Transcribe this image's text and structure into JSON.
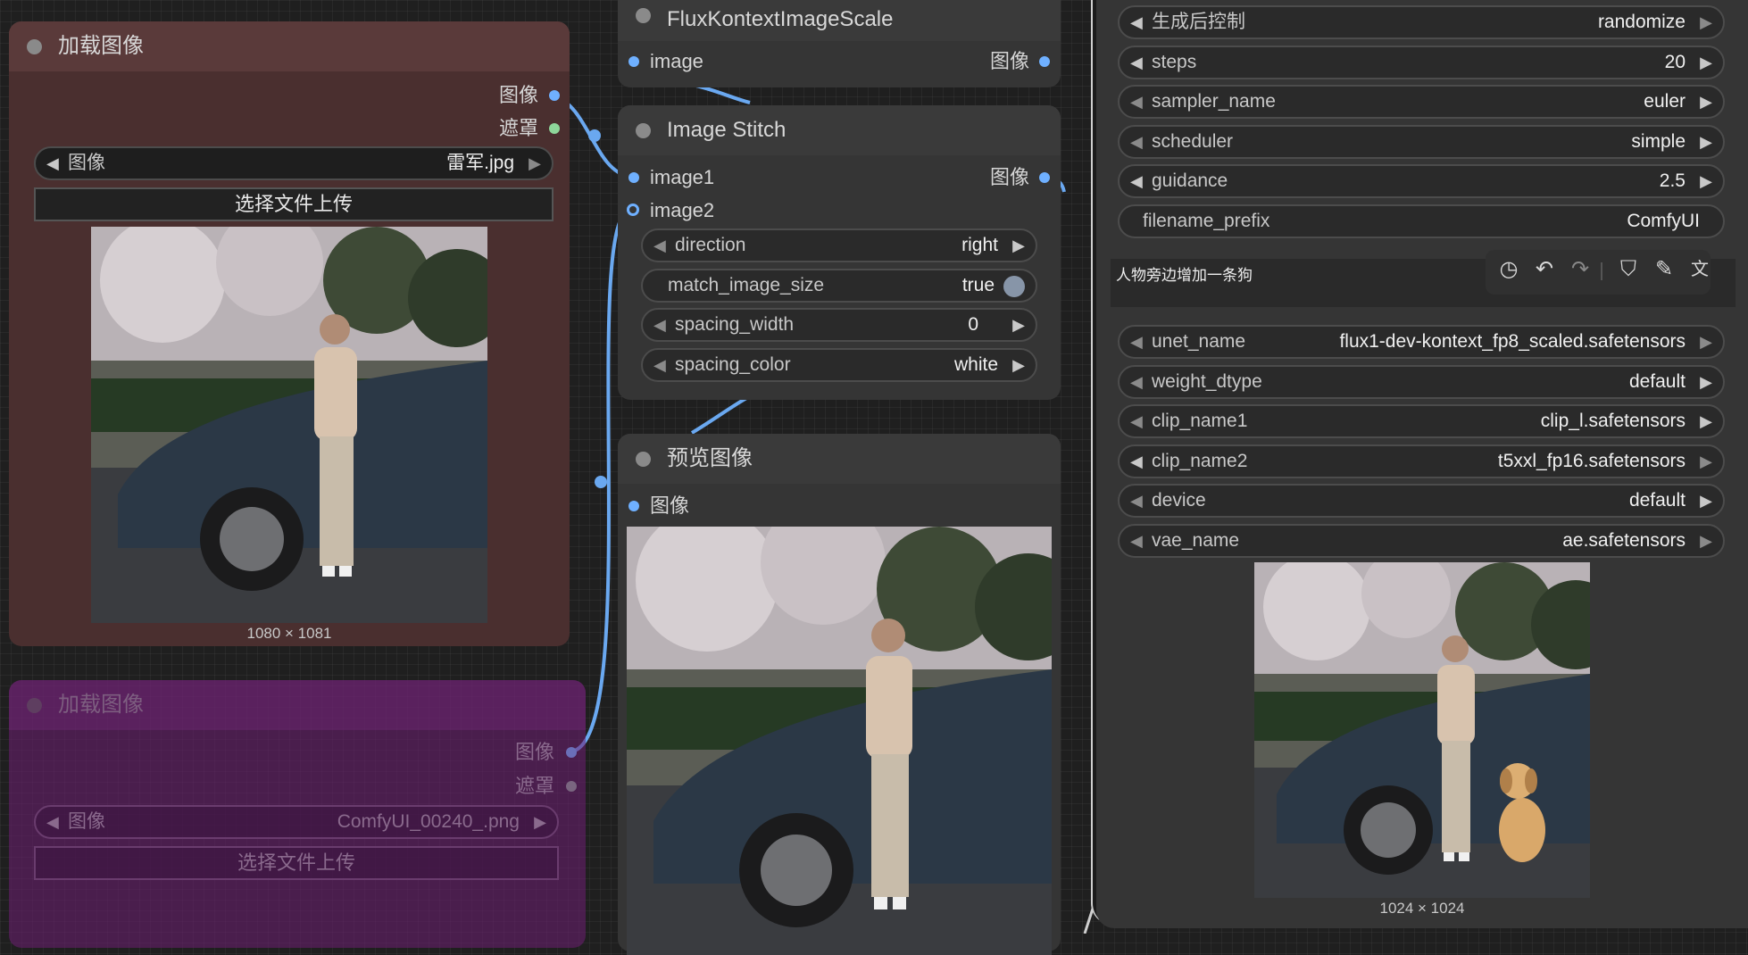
{
  "nodes": {
    "load_image_1": {
      "title": "加载图像",
      "out_image": "图像",
      "out_mask": "遮罩",
      "image_widget_label": "图像",
      "image_widget_value": "雷军.jpg",
      "upload_button": "选择文件上传",
      "size": "1080 × 1081"
    },
    "load_image_2": {
      "title": "加载图像",
      "out_image": "图像",
      "out_mask": "遮罩",
      "image_widget_label": "图像",
      "image_widget_value": "ComfyUI_00240_.png",
      "upload_button": "选择文件上传"
    },
    "flux_scale": {
      "title": "FluxKontextImageScale",
      "in_image": "image",
      "out_image": "图像"
    },
    "image_stitch": {
      "title": "Image Stitch",
      "in_image1": "image1",
      "in_image2": "image2",
      "out_image": "图像",
      "widgets": [
        {
          "label": "direction",
          "value": "right"
        },
        {
          "label": "match_image_size",
          "value": "true"
        },
        {
          "label": "spacing_width",
          "value": "0"
        },
        {
          "label": "spacing_color",
          "value": "white"
        }
      ]
    },
    "preview": {
      "title": "预览图像",
      "in_image": "图像"
    },
    "right_panel": {
      "top_widgets": [
        {
          "label": "生成后控制",
          "value": "randomize"
        },
        {
          "label": "steps",
          "value": "20"
        },
        {
          "label": "sampler_name",
          "value": "euler"
        },
        {
          "label": "scheduler",
          "value": "simple"
        },
        {
          "label": "guidance",
          "value": "2.5"
        },
        {
          "label": "filename_prefix",
          "value": "ComfyUI"
        }
      ],
      "prompt_text": "人物旁边增加一条狗",
      "toolbar_icons": [
        "history-icon",
        "undo-icon",
        "redo-icon",
        "bookmark-icon",
        "magic-wand-icon",
        "translate-icon"
      ],
      "model_widgets": [
        {
          "label": "unet_name",
          "value": "flux1-dev-kontext_fp8_scaled.safetensors"
        },
        {
          "label": "weight_dtype",
          "value": "default"
        },
        {
          "label": "clip_name1",
          "value": "clip_l.safetensors"
        },
        {
          "label": "clip_name2",
          "value": "t5xxl_fp16.safetensors"
        },
        {
          "label": "device",
          "value": "default"
        },
        {
          "label": "vae_name",
          "value": "ae.safetensors"
        }
      ],
      "output_size": "1024 × 1024"
    }
  },
  "colors": {
    "link": "#6aa8f0",
    "load_node_bg": "#4a2f2f",
    "load_node_title": "#5a3a3a",
    "purple_node_bg": "#4a1f4e",
    "gray_node_bg": "#353535"
  }
}
